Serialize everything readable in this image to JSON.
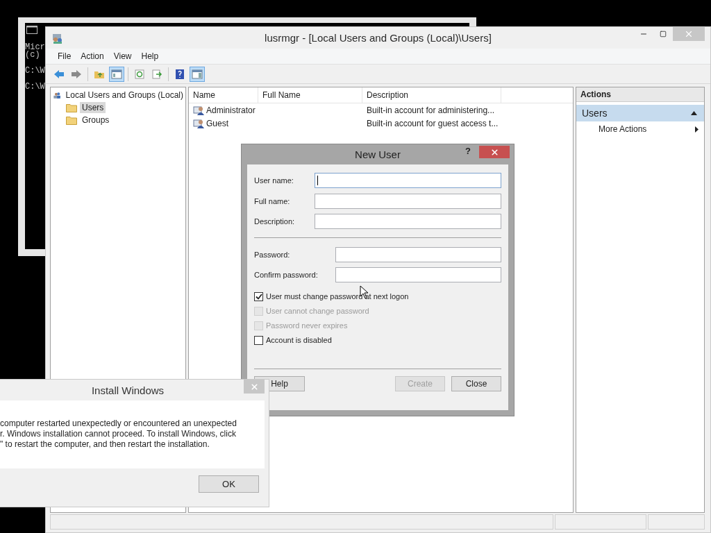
{
  "console": {
    "lines": [
      "Micr",
      "(c)",
      "C:\\W",
      "C:\\W"
    ]
  },
  "main_window": {
    "title": "lusrmgr - [Local Users and Groups (Local)\\Users]",
    "menu": [
      "File",
      "Action",
      "View",
      "Help"
    ],
    "toolbar": [
      {
        "kind": "back",
        "pressed": false
      },
      {
        "kind": "forward",
        "pressed": false
      },
      {
        "kind": "separator"
      },
      {
        "kind": "up",
        "pressed": false
      },
      {
        "kind": "tree",
        "pressed": true
      },
      {
        "kind": "separator"
      },
      {
        "kind": "refresh",
        "pressed": false
      },
      {
        "kind": "export",
        "pressed": false
      },
      {
        "kind": "separator"
      },
      {
        "kind": "help",
        "pressed": false
      },
      {
        "kind": "pane",
        "pressed": true
      }
    ],
    "tree": [
      {
        "label": "Local Users and Groups (Local)",
        "kind": "root",
        "selected": false,
        "children": [
          {
            "label": "Users",
            "kind": "folder",
            "selected": true
          },
          {
            "label": "Groups",
            "kind": "folder",
            "selected": false
          }
        ]
      }
    ],
    "columns": [
      "Name",
      "Full Name",
      "Description"
    ],
    "rows": [
      {
        "name": "Administrator",
        "description": "Built-in account for administering..."
      },
      {
        "name": "Guest",
        "description": "Built-in account for guest access t..."
      }
    ],
    "actions": {
      "header": "Actions",
      "section": "Users",
      "expanded": true,
      "items": [
        "More Actions"
      ]
    }
  },
  "new_user_dialog": {
    "title": "New User",
    "help_mark": "?",
    "fields": [
      {
        "label": "User name:",
        "focused": true
      },
      {
        "label": "Full name:",
        "focused": false
      },
      {
        "label": "Description:",
        "focused": false
      }
    ],
    "password_fields": [
      {
        "label": "Password:",
        "focused": false
      },
      {
        "label": "Confirm password:",
        "focused": false
      }
    ],
    "options": [
      {
        "label": "User must change password at next logon",
        "checked": true,
        "disabled": false
      },
      {
        "label": "User cannot change password",
        "checked": false,
        "disabled": true
      },
      {
        "label": "Password never expires",
        "checked": false,
        "disabled": true
      },
      {
        "label": "Account is disabled",
        "checked": false,
        "disabled": false
      }
    ],
    "buttons": [
      {
        "label": "Help",
        "disabled": false
      },
      {
        "label": "Create",
        "disabled": true
      },
      {
        "label": "Close",
        "disabled": false
      }
    ]
  },
  "install_dialog": {
    "title": "Install Windows",
    "lines": [
      "computer restarted unexpectedly or encountered an unexpected",
      "r. Windows installation cannot proceed. To install Windows, click",
      "\" to restart the computer, and then restart the installation."
    ],
    "button": "OK"
  }
}
